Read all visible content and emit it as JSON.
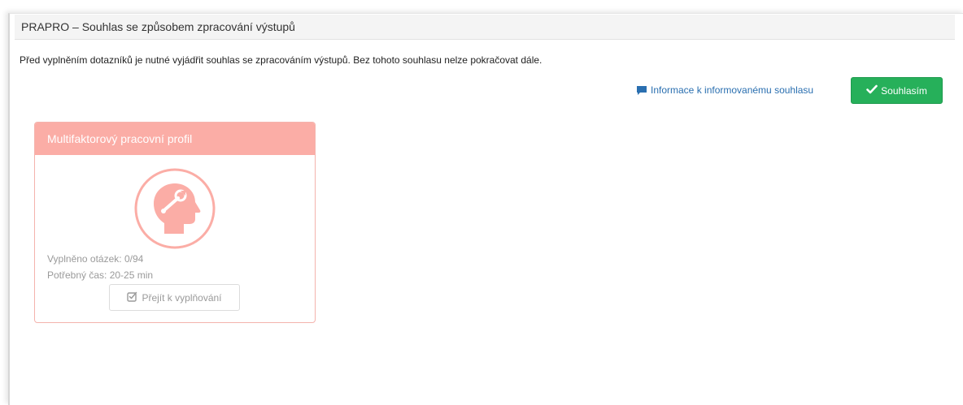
{
  "header": {
    "title": "PRAPRO – Souhlas se způsobem zpracování výstupů"
  },
  "intro": {
    "text": "Před vyplněním dotazníků je nutné vyjádřit souhlas se zpracováním výstupů. Bez tohoto souhlasu nelze pokračovat dále."
  },
  "actions": {
    "info_link_label": "Informace k informovanému souhlasu",
    "info_icon": "comment-icon",
    "agree_label": "Souhlasím",
    "agree_icon": "check-icon",
    "agree_color": "#26b05a"
  },
  "card": {
    "title": "Multifaktorový pracovní profil",
    "accent_color": "#fbada6",
    "icon": "head-with-wrench-icon",
    "questions_filled": "Vyplněno otázek: 0/94",
    "time_needed": "Potřebný čas: 20-25 min",
    "go_button_label": "Přejít k vyplňování",
    "go_button_icon": "edit-check-icon"
  }
}
